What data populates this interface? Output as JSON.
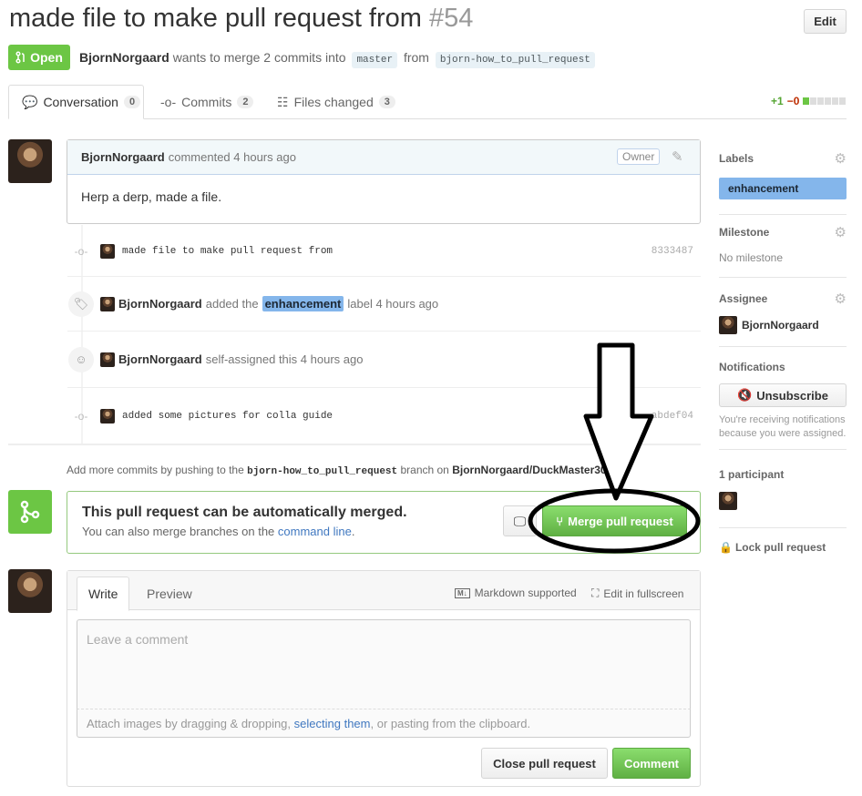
{
  "pr": {
    "title": "made file to make pull request from",
    "number": "#54",
    "edit_label": "Edit",
    "state_label": "Open",
    "author": "BjornNorgaard",
    "meta_text": "wants to merge 2 commits into",
    "base_branch": "master",
    "from_text": "from",
    "head_branch": "bjorn-how_to_pull_request"
  },
  "tabs": [
    {
      "label": "Conversation",
      "count": "0"
    },
    {
      "label": "Commits",
      "count": "2"
    },
    {
      "label": "Files changed",
      "count": "3"
    }
  ],
  "diffstat": {
    "additions": "+1",
    "deletions": "−0"
  },
  "comment": {
    "author": "BjornNorgaard",
    "action": "commented 4 hours ago",
    "badge": "Owner",
    "body": "Herp a derp, made a file."
  },
  "timeline": [
    {
      "type": "commit",
      "message": "made file to make pull request from",
      "sha": "8333487"
    },
    {
      "type": "label",
      "author": "BjornNorgaard",
      "pre": "added the",
      "label": "enhancement",
      "post": "label 4 hours ago"
    },
    {
      "type": "assign",
      "author": "BjornNorgaard",
      "text": "self-assigned this 4 hours ago"
    },
    {
      "type": "commit",
      "message": "added some pictures for colla guide",
      "sha": "abdef04"
    }
  ],
  "push_note": {
    "pre": "Add more commits by pushing to the",
    "branch": "bjorn-how_to_pull_request",
    "mid": "branch on",
    "repo": "BjornNorgaard/DuckMaster3000"
  },
  "merge": {
    "title": "This pull request can be automatically merged.",
    "sub_pre": "You can also merge branches on the",
    "sub_link": "command line",
    "sub_post": ".",
    "button": "Merge pull request"
  },
  "new_comment": {
    "tab_write": "Write",
    "tab_preview": "Preview",
    "markdown": "Markdown supported",
    "fullscreen": "Edit in fullscreen",
    "placeholder": "Leave a comment",
    "hint_pre": "Attach images by dragging & dropping,",
    "hint_link": "selecting them",
    "hint_post": ", or pasting from the clipboard.",
    "close_button": "Close pull request",
    "comment_button": "Comment"
  },
  "sidebar": {
    "labels_title": "Labels",
    "label": "enhancement",
    "milestone_title": "Milestone",
    "milestone_value": "No milestone",
    "assignee_title": "Assignee",
    "assignee": "BjornNorgaard",
    "notifications_title": "Notifications",
    "unsubscribe": "Unsubscribe",
    "notif_note": "You're receiving notifications because you were assigned.",
    "participants_title": "1 participant",
    "lock": "Lock pull request"
  },
  "colors": {
    "open_green": "#6cc644",
    "label_blue": "#84b6eb",
    "link_blue": "#4078c0"
  }
}
